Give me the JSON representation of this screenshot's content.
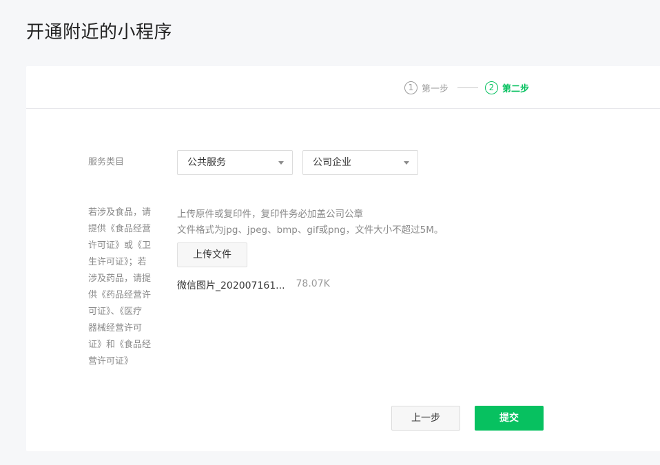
{
  "page": {
    "title": "开通附近的小程序"
  },
  "steps": [
    {
      "num": "1",
      "label": "第一步"
    },
    {
      "num": "2",
      "label": "第二步"
    }
  ],
  "service_category": {
    "label": "服务类目",
    "primary": "公共服务",
    "secondary": "公司企业"
  },
  "license": {
    "label_lines": [
      "若涉及食品，请",
      "提供《食品经营",
      "许可证》或《卫",
      "生许可证》；若",
      "涉及药品，请提",
      "供《药品经营许",
      "可证》、《医疗",
      "器械经营许可",
      "证》和《食品经",
      "营许可证》"
    ],
    "hint_line1": "上传原件或复印件，复印件务必加盖公司公章",
    "hint_line2": "文件格式为jpg、jpeg、bmp、gif或png，文件大小不超过5M。",
    "upload_label": "上传文件",
    "file": {
      "name": "微信图片_202007161...",
      "size": "78.07K"
    }
  },
  "actions": {
    "prev_label": "上一步",
    "submit_label": "提交"
  },
  "colors": {
    "accent": "#07c160",
    "background": "#f6f7f9",
    "muted_text": "#8a8a8a"
  }
}
